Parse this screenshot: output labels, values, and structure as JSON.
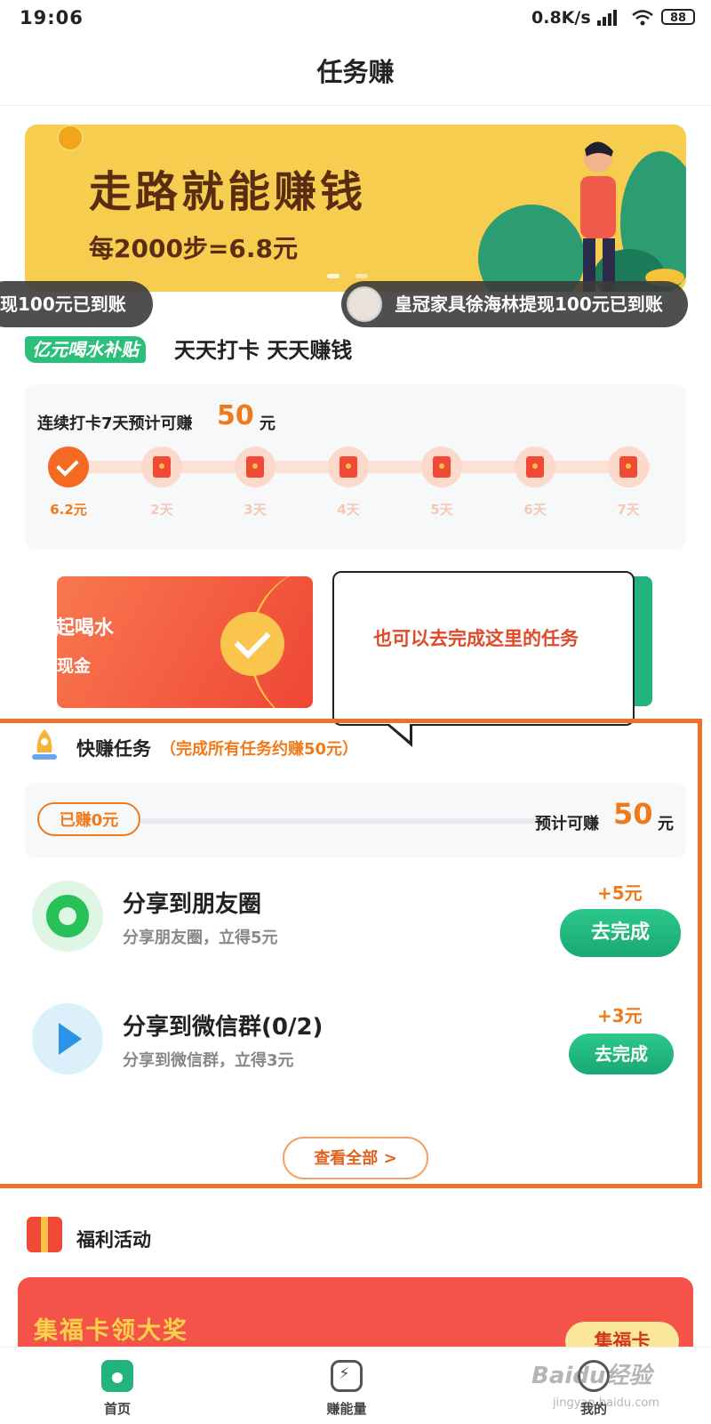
{
  "status_bar": {
    "time": "19:06",
    "network_speed": "0.8K/s",
    "battery": "88"
  },
  "header": {
    "title": "任务赚"
  },
  "banner": {
    "title": "走路就能赚钱",
    "subtitle": "每2000步=6.8元"
  },
  "ticker": {
    "left_text": "现100元已到账",
    "right_text": "皇冠家具徐海林提现100元已到账"
  },
  "drink_subsidy": {
    "tag": "亿元喝水补贴",
    "tagline": "天天打卡 天天赚钱"
  },
  "sign_in": {
    "title": "连续打卡7天预计可赚",
    "amount": "50",
    "unit": "元",
    "steps": [
      "6.2元",
      "2天",
      "3天",
      "4天",
      "5天",
      "6天",
      "7天"
    ]
  },
  "promo_card": {
    "line1": "早起喝水",
    "line2": "领现金"
  },
  "tooltip": {
    "text": "也可以去完成这里的任务"
  },
  "quick_tasks": {
    "title": "快赚任务",
    "subtitle": "（完成所有任务约赚50元）",
    "earned": "已赚0元",
    "estimate_label": "预计可赚",
    "estimate_amount": "50",
    "estimate_unit": "元",
    "tasks": [
      {
        "name": "分享到朋友圈",
        "desc": "分享朋友圈，立得5元",
        "reward": "+5元",
        "button": "去完成"
      },
      {
        "name": "分享到微信群(0/2)",
        "desc": "分享到微信群，立得3元",
        "reward": "+3元",
        "button": "去完成"
      }
    ],
    "view_all": "查看全部 >"
  },
  "welfare": {
    "title": "福利活动",
    "card_title": "集福卡领大奖",
    "card_button": "集福卡"
  },
  "nav": {
    "home": "首页",
    "energy": "赚能量",
    "me": "我的"
  },
  "watermark": {
    "text": "Baidu经验",
    "sub": "jingyan.baidu.com"
  },
  "colors": {
    "accent_orange": "#f07a1a",
    "brand_green": "#22b47c",
    "banner_yellow": "#f6cd4e"
  }
}
